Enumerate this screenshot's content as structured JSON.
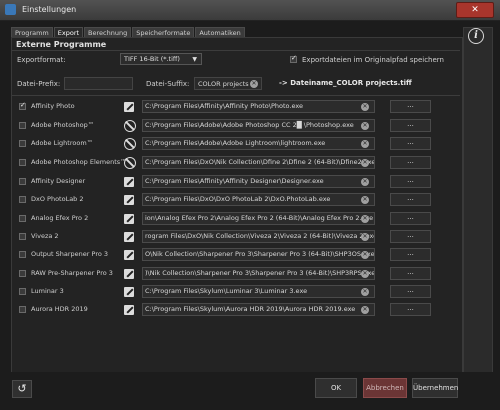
{
  "window": {
    "title": "Einstellungen",
    "close": "✕"
  },
  "tabs": [
    "Programm",
    "Export",
    "Berechnung",
    "Speicherformate",
    "Automatiken"
  ],
  "section_title": "Externe Programme",
  "export": {
    "format_label": "Exportformat:",
    "format_value": "TIFF 16-Bit (*.tiff)",
    "save_original_label": "Exportdateien im Originalpfad speichern",
    "save_original_checked": true,
    "prefix_label": "Datei-Prefix:",
    "prefix_value": "",
    "suffix_label": "Datei-Suffix:",
    "suffix_value": "COLOR projects",
    "preview": "-> Dateiname_COLOR projects.tiff"
  },
  "programs": [
    {
      "name": "Affinity Photo",
      "checked": true,
      "icon": "edit",
      "path": "C:\\Program Files\\Affinity\\Affinity Photo\\Photo.exe"
    },
    {
      "name": "Adobe Photoshop™",
      "checked": false,
      "icon": "noentry",
      "path": "C:\\Program Files\\Adobe\\Adobe Photoshop CC 2█   \\Photoshop.exe"
    },
    {
      "name": "Adobe Lightroom™",
      "checked": false,
      "icon": "noentry",
      "path": "C:\\Program Files\\Adobe\\Adobe Lightroom\\lightroom.exe"
    },
    {
      "name": "Adobe Photoshop Elements™",
      "checked": false,
      "icon": "noentry",
      "path": "C:\\Program Files\\DxO\\Nik Collection\\Dfine 2\\Dfine 2 (64-Bit)\\Dfine2.exe"
    },
    {
      "name": "Affinity Designer",
      "checked": false,
      "icon": "edit",
      "path": "C:\\Program Files\\Affinity\\Affinity Designer\\Designer.exe"
    },
    {
      "name": "DxO PhotoLab 2",
      "checked": false,
      "icon": "edit",
      "path": "C:\\Program Files\\DxO\\DxO PhotoLab 2\\DxO.PhotoLab.exe"
    },
    {
      "name": "Analog Efex Pro 2",
      "checked": false,
      "icon": "edit",
      "path": "ion\\Analog Efex Pro 2\\Analog Efex Pro 2 (64-Bit)\\Analog Efex Pro 2.exe"
    },
    {
      "name": "Viveza 2",
      "checked": false,
      "icon": "edit",
      "path": "rogram Files\\DxO\\Nik Collection\\Viveza 2\\Viveza 2 (64-Bit)\\Viveza 2.exe"
    },
    {
      "name": "Output Sharpener Pro 3",
      "checked": false,
      "icon": "edit",
      "path": "O\\Nik Collection\\Sharpener Pro 3\\Sharpener Pro 3 (64-Bit)\\SHP3OS.exe"
    },
    {
      "name": "RAW Pre-Sharpener Pro 3",
      "checked": false,
      "icon": "edit",
      "path": ")\\Nik Collection\\Sharpener Pro 3\\Sharpener Pro 3 (64-Bit)\\SHP3RPS.exe"
    },
    {
      "name": "Luminar 3",
      "checked": false,
      "icon": "edit",
      "path": "C:\\Program Files\\Skylum\\Luminar 3\\Luminar 3.exe"
    },
    {
      "name": "Aurora HDR 2019",
      "checked": false,
      "icon": "edit",
      "path": "C:\\Program Files\\Skylum\\Aurora HDR 2019\\Aurora HDR 2019.exe"
    }
  ],
  "browse_label": "...",
  "clear_symbol": "✕",
  "info_symbol": "i",
  "undo_symbol": "↺",
  "buttons": {
    "ok": "OK",
    "cancel": "Abbrechen",
    "apply": "Übernehmen"
  },
  "colors": {
    "cancel_bg": "#6b3535",
    "close_bg": "#a8352c",
    "background": "#1c1c1c"
  }
}
